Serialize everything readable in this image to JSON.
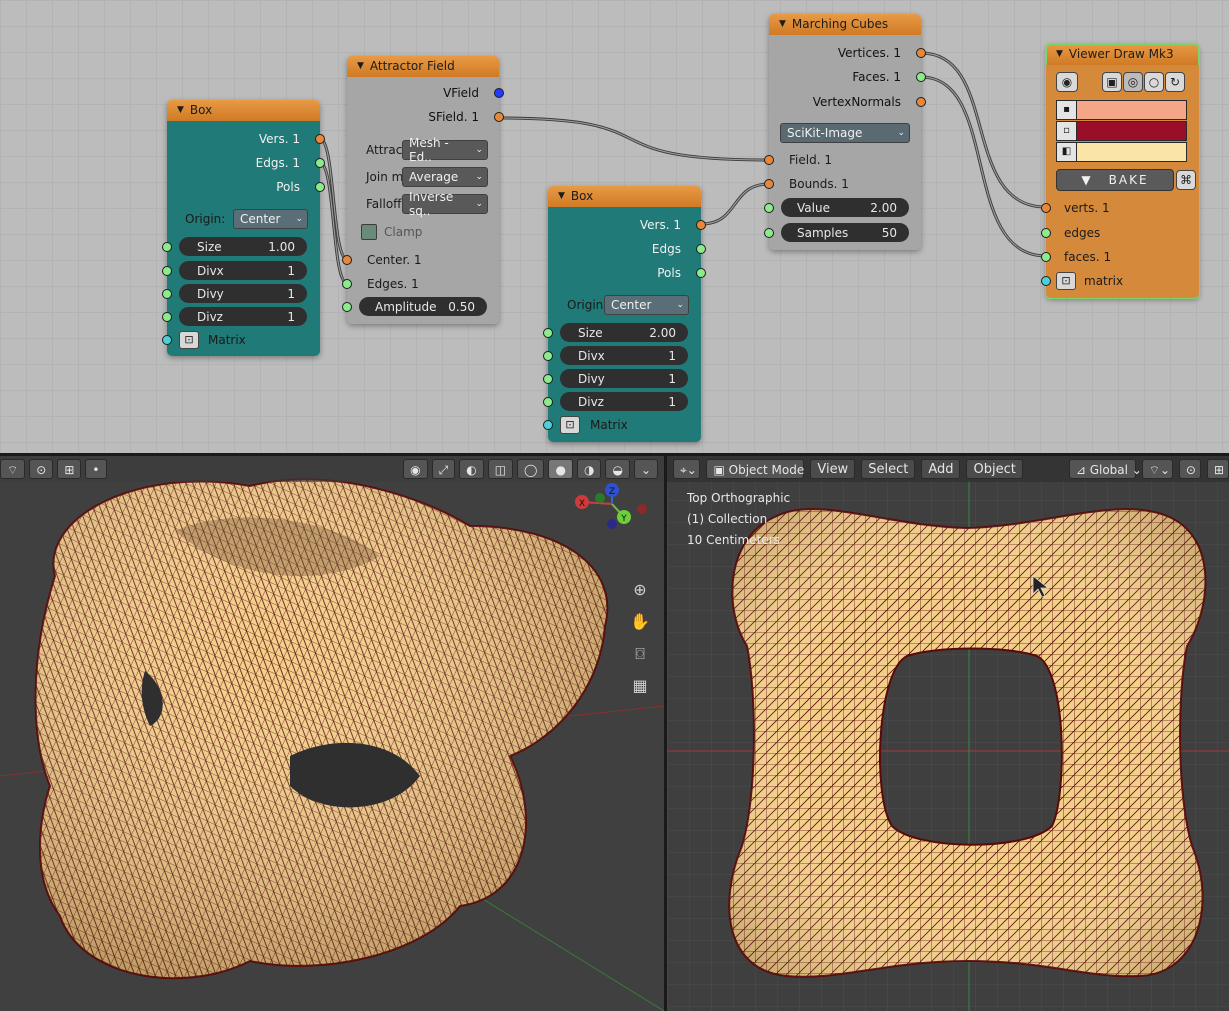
{
  "colors": {
    "socket_vertices": "#e8873a",
    "socket_data": "#8ceb8c",
    "socket_vfield": "#1f3cff",
    "socket_matrix": "#4ad1d9",
    "node_header": "#e08a35",
    "mesh_fill": "#f3d089",
    "mesh_wire": "#5a0a0a",
    "swatch_vertex": "#f6a688",
    "swatch_edge": "#9a0e2a",
    "swatch_face": "#fbe4a8"
  },
  "nodes": {
    "box1": {
      "title": "Box",
      "outputs": [
        "Vers. 1",
        "Edgs. 1",
        "Pols"
      ],
      "origin_label": "Origin:",
      "origin_value": "Center",
      "fields": [
        {
          "label": "Size",
          "value": "1.00"
        },
        {
          "label": "Divx",
          "value": "1"
        },
        {
          "label": "Divy",
          "value": "1"
        },
        {
          "label": "Divz",
          "value": "1"
        }
      ],
      "matrix_label": "Matrix"
    },
    "attractor": {
      "title": "Attractor Field",
      "outputs": [
        "VField",
        "SField. 1"
      ],
      "attract_label": "Attract",
      "attract_value": "Mesh - Ed..",
      "join_label": "Join m",
      "join_value": "Average",
      "falloff_label": "Falloff",
      "falloff_value": "Inverse sq..",
      "clamp_label": "Clamp",
      "inputs": [
        "Center. 1",
        "Edges. 1"
      ],
      "amplitude_label": "Amplitude",
      "amplitude_value": "0.50"
    },
    "box2": {
      "title": "Box",
      "outputs": [
        "Vers. 1",
        "Edgs",
        "Pols"
      ],
      "origin_label": "Origin:",
      "origin_value": "Center",
      "fields": [
        {
          "label": "Size",
          "value": "2.00"
        },
        {
          "label": "Divx",
          "value": "1"
        },
        {
          "label": "Divy",
          "value": "1"
        },
        {
          "label": "Divz",
          "value": "1"
        }
      ],
      "matrix_label": "Matrix"
    },
    "marching": {
      "title": "Marching Cubes",
      "outputs": [
        "Vertices. 1",
        "Faces. 1",
        "VertexNormals"
      ],
      "mode_value": "SciKit-Image",
      "inputs": [
        "Field. 1",
        "Bounds. 1"
      ],
      "value_label": "Value",
      "value_value": "2.00",
      "samples_label": "Samples",
      "samples_value": "50"
    },
    "viewer": {
      "title": "Viewer Draw Mk3",
      "bake_label": "BAKE",
      "inputs": [
        "verts. 1",
        "edges",
        "faces. 1",
        "matrix"
      ]
    }
  },
  "viewport_right": {
    "mode": "Object Mode",
    "menus": [
      "View",
      "Select",
      "Add",
      "Object"
    ],
    "orientation": "Global",
    "overlay": [
      "Top Orthographic",
      "(1) Collection",
      "10 Centimeters"
    ]
  },
  "icons": {
    "eye": "eye-icon",
    "bake_triangle": "triangle-icon",
    "zoom": "zoom-icon",
    "hand": "hand-icon",
    "camera": "camera-icon",
    "grid": "grid-icon"
  },
  "gizmo": {
    "x": "X",
    "y": "Y",
    "z": "Z"
  }
}
